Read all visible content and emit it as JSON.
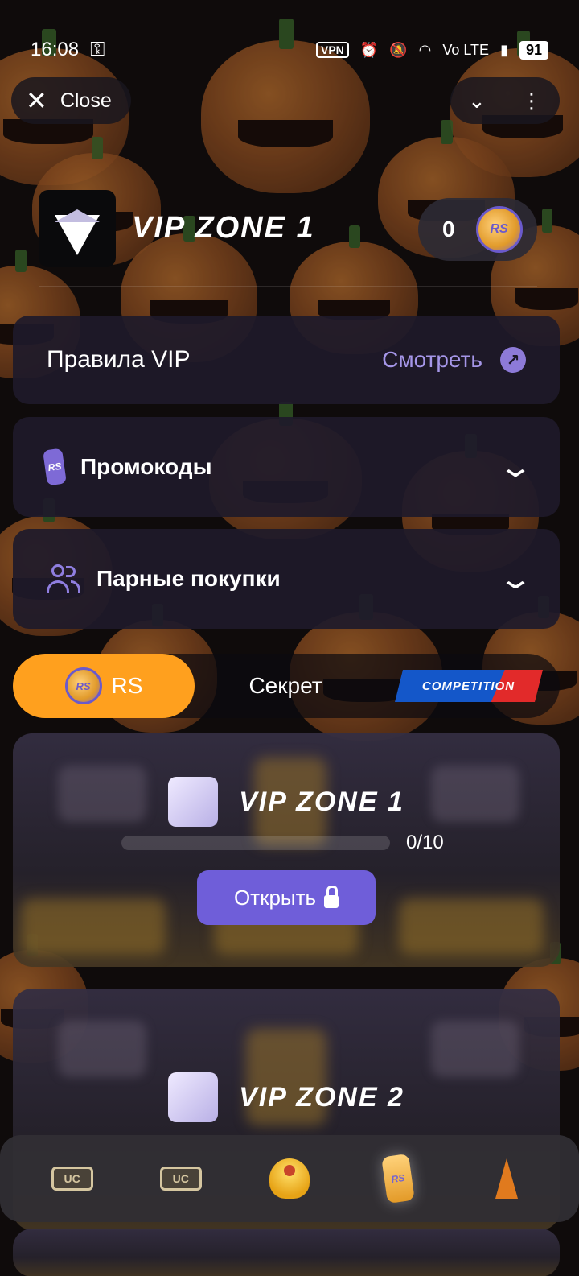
{
  "status_bar": {
    "time": "16:08",
    "vpn": "VPN",
    "network": "Vo LTE",
    "battery": "91"
  },
  "topbar": {
    "close_label": "Close"
  },
  "header": {
    "title": "VIP ZONE 1",
    "balance": "0",
    "coin_label": "RS"
  },
  "rules": {
    "label": "Правила VIP",
    "link": "Смотреть"
  },
  "accordions": {
    "promo": "Промокоды",
    "pair": "Парные покупки"
  },
  "tabs": {
    "rs": "RS",
    "secret": "Секрет",
    "competition": "COMPETITION"
  },
  "cards": [
    {
      "title": "VIP ZONE 1",
      "progress_text": "0/10",
      "progress_value": 0,
      "button": "Открыть"
    },
    {
      "title": "VIP ZONE 2"
    }
  ],
  "bottom_nav": {
    "uc1": "UC",
    "uc2": "UC",
    "rs": "RS"
  },
  "colors": {
    "accent": "#6f5ed9",
    "active_tab": "#ffa01e",
    "link": "#a596e8"
  }
}
